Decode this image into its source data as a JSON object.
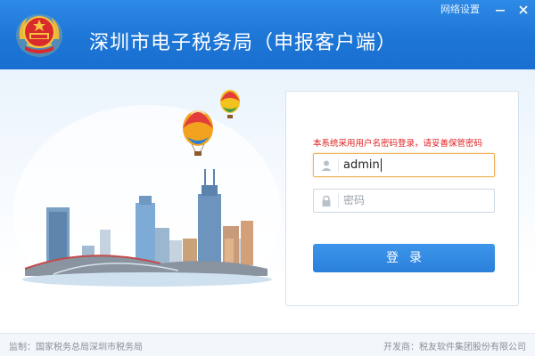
{
  "header": {
    "title": "深圳市电子税务局（申报客户端）",
    "network_settings": "网络设置",
    "logo_icon": "tax-emblem-icon",
    "minimize_icon": "minimize-icon",
    "close_icon": "close-icon",
    "colors": {
      "bar_top": "#2e8ae6",
      "bar_bottom": "#1a6fd0"
    }
  },
  "login": {
    "notice": "本系统采用用户名密码登录，请妥善保管密码",
    "username": {
      "value": "admin",
      "icon": "user-icon"
    },
    "password": {
      "placeholder": "密码",
      "icon": "lock-icon"
    },
    "submit_label": "登录",
    "colors": {
      "notice": "#e02020",
      "button": "#2a80da",
      "active_border": "#f0b25c"
    }
  },
  "illustration": {
    "description_icon": "city-skyline-hot-air-balloons-icon"
  },
  "footer": {
    "supervisor": "监制：国家税务总局深圳市税务局",
    "developer": "开发商：税友软件集团股份有限公司"
  }
}
